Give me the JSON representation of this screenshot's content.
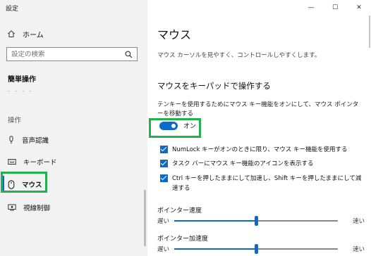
{
  "window": {
    "title": "設定",
    "controls": [
      "—",
      "☐",
      "✕"
    ]
  },
  "sidebar": {
    "home_label": "ホーム",
    "search_placeholder": "設定の検索",
    "section_title": "簡単操作",
    "dashes": "- - - -",
    "category_label": "操作",
    "items": [
      {
        "label": "音声認識",
        "icon": "microphone-icon"
      },
      {
        "label": "キーボード",
        "icon": "keyboard-icon"
      },
      {
        "label": "マウス",
        "icon": "mouse-icon",
        "active": true
      },
      {
        "label": "視線制御",
        "icon": "eye-control-icon"
      }
    ]
  },
  "main": {
    "title": "マウス",
    "description": "マウス カーソルを見やすく、コントロールしやすくします。",
    "section_title": "マウスをキーパッドで操作する",
    "toggle_description": "テンキーを使用するためにマウス キー機能をオンにして、マウス ポインターを移動する",
    "toggle_state_label": "オン",
    "toggle_on": true,
    "checkboxes": [
      {
        "label": "NumLock キーがオンのときに限り、マウス キー機能を使用する",
        "checked": true
      },
      {
        "label": "タスク バーにマウス キー機能のアイコンを表示する",
        "checked": true
      },
      {
        "label": "Ctrl キーを押したままにして加速し、Shift キーを押したままにして減速する",
        "checked": true
      }
    ],
    "sliders": [
      {
        "label": "ポインター速度",
        "min_label": "遅い",
        "max_label": "速い",
        "value": 0.5
      },
      {
        "label": "ポインター加速度",
        "min_label": "遅い",
        "max_label": "速い",
        "value": 0.5
      }
    ]
  },
  "colors": {
    "accent": "#0b6bcb",
    "highlight": "#22b14c",
    "sidebar_bg": "#f2f2f2"
  }
}
